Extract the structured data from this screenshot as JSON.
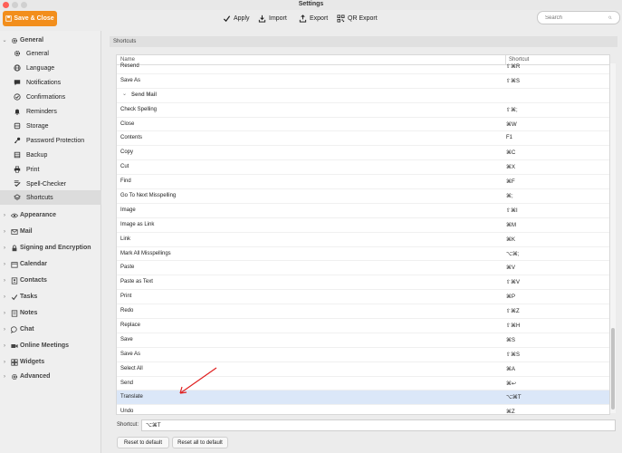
{
  "window": {
    "title": "Settings"
  },
  "toolbar": {
    "save_close": "Save & Close",
    "apply": "Apply",
    "import": "Import",
    "export": "Export",
    "qr_export": "QR Export",
    "search_placeholder": "Search"
  },
  "sidebar": {
    "general_section": "General",
    "general_items": [
      {
        "label": "General",
        "icon": "gear-icon"
      },
      {
        "label": "Language",
        "icon": "globe-icon"
      },
      {
        "label": "Notifications",
        "icon": "speech-bubble-icon"
      },
      {
        "label": "Confirmations",
        "icon": "check-circle-icon"
      },
      {
        "label": "Reminders",
        "icon": "bell-icon"
      },
      {
        "label": "Storage",
        "icon": "database-icon"
      },
      {
        "label": "Password Protection",
        "icon": "key-icon"
      },
      {
        "label": "Backup",
        "icon": "backup-icon"
      },
      {
        "label": "Print",
        "icon": "printer-icon"
      },
      {
        "label": "Spell-Checker",
        "icon": "spellcheck-icon"
      },
      {
        "label": "Shortcuts",
        "icon": "layers-icon"
      }
    ],
    "sections": [
      {
        "label": "Appearance",
        "icon": "eye-icon"
      },
      {
        "label": "Mail",
        "icon": "envelope-icon"
      },
      {
        "label": "Signing and Encryption",
        "icon": "lock-icon"
      },
      {
        "label": "Calendar",
        "icon": "calendar-icon"
      },
      {
        "label": "Contacts",
        "icon": "contacts-icon"
      },
      {
        "label": "Tasks",
        "icon": "checkmark-icon"
      },
      {
        "label": "Notes",
        "icon": "note-icon"
      },
      {
        "label": "Chat",
        "icon": "chat-icon"
      },
      {
        "label": "Online Meetings",
        "icon": "video-icon"
      },
      {
        "label": "Widgets",
        "icon": "widgets-icon"
      },
      {
        "label": "Advanced",
        "icon": "gear-icon"
      }
    ]
  },
  "main": {
    "header": "Shortcuts",
    "columns": {
      "name": "Name",
      "shortcut": "Shortcut"
    },
    "rows": [
      {
        "name": "Resend",
        "key": "⇧⌘R"
      },
      {
        "name": "Save As",
        "key": "⇧⌘S"
      },
      {
        "name": "Send Mail",
        "key": "",
        "group": true
      },
      {
        "name": "Check Spelling",
        "key": "⇧⌘;"
      },
      {
        "name": "Close",
        "key": "⌘W"
      },
      {
        "name": "Contents",
        "key": "F1"
      },
      {
        "name": "Copy",
        "key": "⌘C"
      },
      {
        "name": "Cut",
        "key": "⌘X"
      },
      {
        "name": "Find",
        "key": "⌘F"
      },
      {
        "name": "Go To Next Misspelling",
        "key": "⌘;"
      },
      {
        "name": "Image",
        "key": "⇧⌘I"
      },
      {
        "name": "Image as Link",
        "key": "⌘M"
      },
      {
        "name": "Link",
        "key": "⌘K"
      },
      {
        "name": "Mark All Misspellings",
        "key": "⌥⌘;"
      },
      {
        "name": "Paste",
        "key": "⌘V"
      },
      {
        "name": "Paste as Text",
        "key": "⇧⌘V"
      },
      {
        "name": "Print",
        "key": "⌘P"
      },
      {
        "name": "Redo",
        "key": "⇧⌘Z"
      },
      {
        "name": "Replace",
        "key": "⇧⌘H"
      },
      {
        "name": "Save",
        "key": "⌘S"
      },
      {
        "name": "Save As",
        "key": "⇧⌘S"
      },
      {
        "name": "Select All",
        "key": "⌘A"
      },
      {
        "name": "Send",
        "key": "⌘↩"
      },
      {
        "name": "Translate",
        "key": "⌥⌘T",
        "selected": true
      },
      {
        "name": "Undo",
        "key": "⌘Z"
      }
    ],
    "shortcut_label": "Shortcut:",
    "shortcut_value": "⌥⌘T",
    "reset_default": "Reset to default",
    "reset_all": "Reset all to default"
  },
  "colors": {
    "accent": "#f28e1c",
    "selection": "#dbe7f8",
    "annotation": "#e02020"
  }
}
